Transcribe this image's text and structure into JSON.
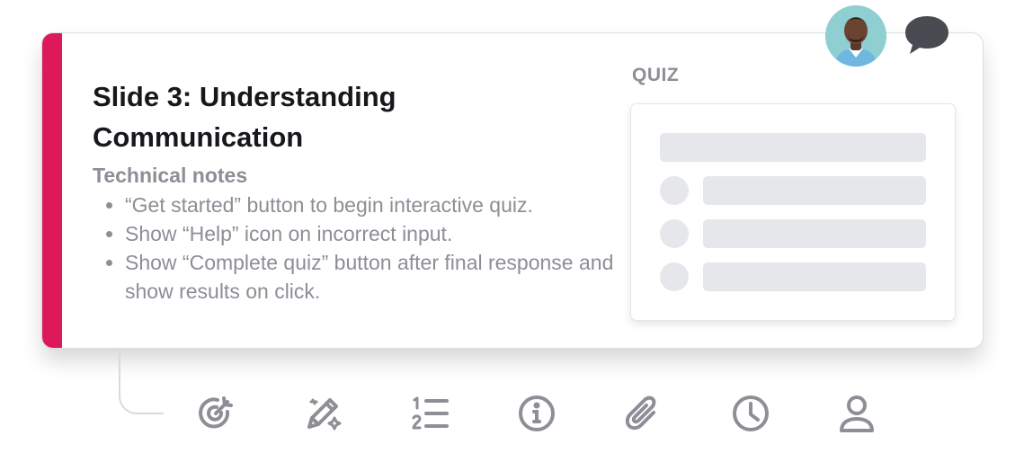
{
  "slide": {
    "title": "Slide 3: Understanding Communication",
    "notes_heading": "Technical notes",
    "notes": [
      "“Get started” button to begin interactive quiz.",
      "Show “Help” icon on incorrect input.",
      "Show “Complete quiz” button after final response and show results on click."
    ],
    "accent_color": "#dc1a59"
  },
  "quiz": {
    "label": "QUIZ",
    "placeholder_options": 3
  },
  "toolbar": {
    "icons": [
      "target-icon",
      "edit-sparkle-icon",
      "numbered-list-icon",
      "info-icon",
      "attachment-icon",
      "clock-icon",
      "user-icon"
    ]
  },
  "header": {
    "avatar": "user-avatar",
    "comment_icon": "chat-bubble-icon"
  },
  "colors": {
    "title": "#17181c",
    "muted_text": "#8d8e96",
    "placeholder": "#e6e7ea",
    "icon": "#8e8e96",
    "chat_icon": "#4a4b52"
  }
}
